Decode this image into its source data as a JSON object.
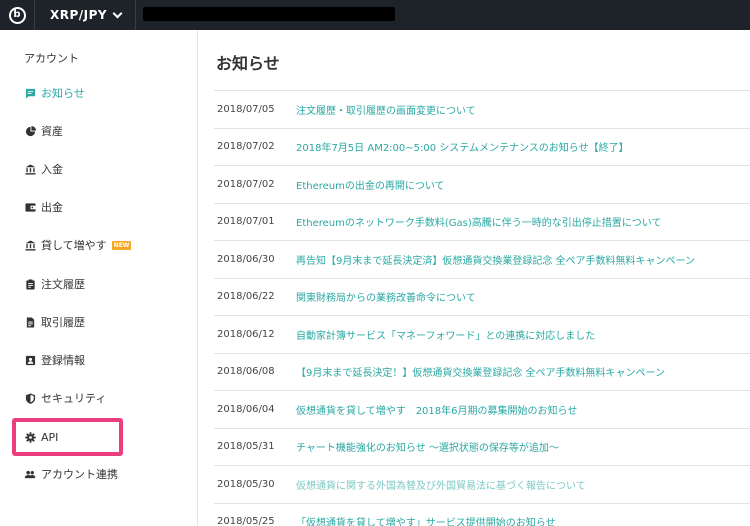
{
  "topbar": {
    "logo_letter": "b",
    "pair_label": "XRP/JPY"
  },
  "sidebar": {
    "heading": "アカウント",
    "items": [
      {
        "label": "お知らせ",
        "icon": "notification-icon",
        "active": true
      },
      {
        "label": "資産",
        "icon": "pie-chart-icon"
      },
      {
        "label": "入金",
        "icon": "bank-icon"
      },
      {
        "label": "出金",
        "icon": "wallet-icon"
      },
      {
        "label": "貸して増やす",
        "icon": "bank-icon",
        "badge": "NEW"
      },
      {
        "label": "注文履歴",
        "icon": "clipboard-icon"
      },
      {
        "label": "取引履歴",
        "icon": "document-icon"
      },
      {
        "label": "登録情報",
        "icon": "id-card-icon"
      },
      {
        "label": "セキュリティ",
        "icon": "shield-icon"
      },
      {
        "label": "API",
        "icon": "gear-icon"
      },
      {
        "label": "アカウント連携",
        "icon": "people-icon"
      }
    ]
  },
  "main": {
    "title": "お知らせ",
    "news": [
      {
        "date": "2018/07/05",
        "title": "注文履歴・取引履歴の画面変更について"
      },
      {
        "date": "2018/07/02",
        "title": "2018年7月5日 AM2:00~5:00 システムメンテナンスのお知らせ【終了】"
      },
      {
        "date": "2018/07/02",
        "title": "Ethereumの出金の再開について"
      },
      {
        "date": "2018/07/01",
        "title": "Ethereumのネットワーク手数料(Gas)高騰に伴う一時的な引出停止措置について"
      },
      {
        "date": "2018/06/30",
        "title": "再告知【9月末まで延長決定済】仮想通貨交換業登録記念 全ペア手数料無料キャンペーン"
      },
      {
        "date": "2018/06/22",
        "title": "関東財務局からの業務改善命令について"
      },
      {
        "date": "2018/06/12",
        "title": "自動家計簿サービス「マネーフォワード」との連携に対応しました"
      },
      {
        "date": "2018/06/08",
        "title": "【9月末まで延長決定！】仮想通貨交換業登録記念 全ペア手数料無料キャンペーン"
      },
      {
        "date": "2018/06/04",
        "title": "仮想通貨を貸して増やす　2018年6月期の募集開始のお知らせ"
      },
      {
        "date": "2018/05/31",
        "title": "チャート機能強化のお知らせ ～選択状態の保存等が追加～"
      },
      {
        "date": "2018/05/30",
        "title": "仮想通貨に関する外国為替及び外国貿易法に基づく報告について"
      },
      {
        "date": "2018/05/25",
        "title": "「仮想通貨を貸して増やす」サービス提供開始のお知らせ"
      }
    ]
  },
  "colors": {
    "topbar": "#1e2229",
    "accent": "#2aa8a3",
    "highlight": "#ec3d7e",
    "badge": "#f5a623"
  }
}
